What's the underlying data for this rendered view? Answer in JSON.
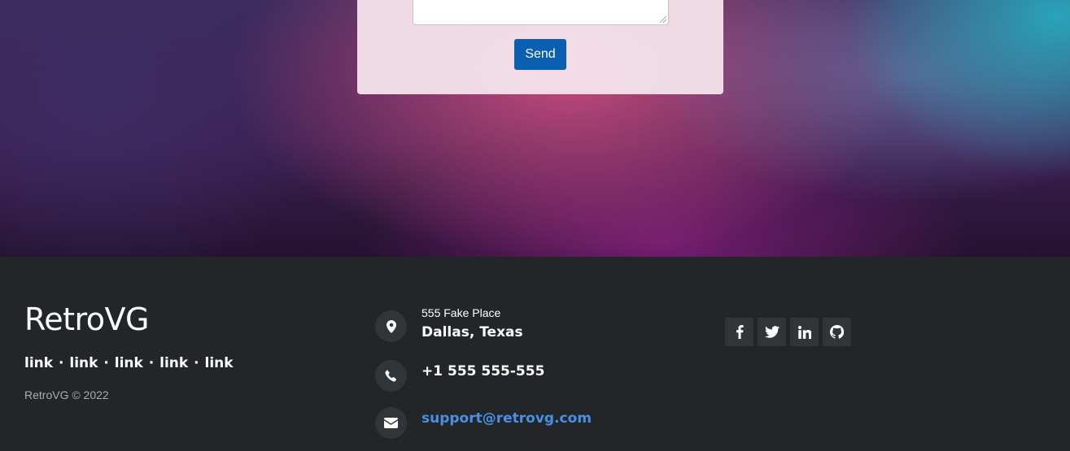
{
  "contact_form": {
    "message_value": "",
    "send_label": "Send"
  },
  "footer": {
    "brand": "RetroVG",
    "links": [
      "link",
      "link",
      "link",
      "link",
      "link"
    ],
    "link_separator": "·",
    "copyright": "RetroVG © 2022",
    "address_line1": "555 Fake Place",
    "address_line2": "Dallas, Texas",
    "phone": "+1 555 555-555",
    "email": "support@retrovg.com",
    "contact_icons": [
      "map-marker-icon",
      "phone-icon",
      "envelope-icon"
    ],
    "social_icons": [
      "facebook-icon",
      "twitter-icon",
      "linkedin-icon",
      "github-icon"
    ]
  },
  "colors": {
    "button_blue": "#0b5fb0",
    "footer_bg": "#222629",
    "email_link": "#4a8fe0"
  }
}
